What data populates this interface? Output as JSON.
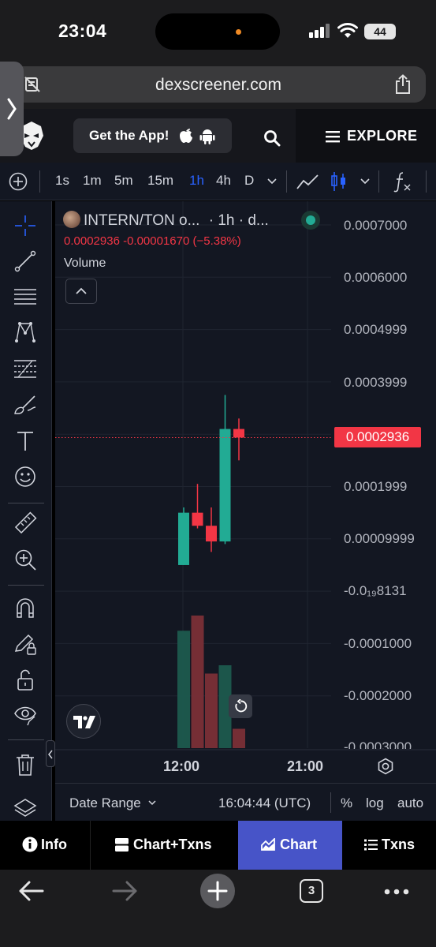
{
  "status_bar": {
    "time": "23:04",
    "battery": "44"
  },
  "browser": {
    "url": "dexscreener.com"
  },
  "site_header": {
    "get_app_label": "Get the App!",
    "explore_label": "EXPLORE"
  },
  "toolbar": {
    "intervals": [
      "1s",
      "1m",
      "5m",
      "15m",
      "1h",
      "4h",
      "D"
    ],
    "active_interval": "1h"
  },
  "chart": {
    "symbol_title": "INTERN/TON o...",
    "interval_suffix": "· 1h · d...",
    "ohlc_line": "0.0002936  -0.00001670 (−5.38%)",
    "volume_label": "Volume",
    "current_price_tag": "0.0002936",
    "y_axis_labels": [
      "0.0007000",
      "0.0006000",
      "0.0004999",
      "0.0003999",
      "0.0001999",
      "0.00009999",
      "-0.0₁₉8131",
      "-0.0001000",
      "-0.0002000",
      "-0.0003000"
    ],
    "x_axis_labels": [
      "12:00",
      "21:00"
    ],
    "colors": {
      "up": "#22ab94",
      "down": "#f23645",
      "background": "#131722",
      "accent": "#2962ff"
    }
  },
  "chart_data": {
    "type": "candlestick",
    "pair": "INTERN/TON",
    "interval": "1h",
    "y_ticks": [
      0.0007,
      0.0006,
      0.0004999,
      0.0003999,
      0.0001999,
      9.999e-05
    ],
    "ylim": [
      -0.0003,
      0.0007
    ],
    "candles": [
      {
        "open": 5e-05,
        "high": 0.00016,
        "low": 5e-05,
        "close": 0.00015,
        "dir": "up"
      },
      {
        "open": 0.00015,
        "high": 0.000205,
        "low": 0.00012,
        "close": 0.000125,
        "dir": "down"
      },
      {
        "open": 0.000125,
        "high": 0.00016,
        "low": 7.5e-05,
        "close": 9.5e-05,
        "dir": "down"
      },
      {
        "open": 9.5e-05,
        "high": 0.000375,
        "low": 9e-05,
        "close": 0.00031,
        "dir": "up"
      },
      {
        "open": 0.00031,
        "high": 0.00033,
        "low": 0.00025,
        "close": 0.0002936,
        "dir": "down"
      }
    ],
    "volume_rel": [
      0.85,
      0.96,
      0.54,
      0.6,
      0.14
    ],
    "current_price": 0.0002936,
    "x_labels": [
      "12:00",
      "21:00"
    ]
  },
  "chart_footer": {
    "date_range": "Date Range",
    "time_utc": "16:04:44 (UTC)",
    "percent": "%",
    "log": "log",
    "auto": "auto"
  },
  "tabs": [
    {
      "label": "Info",
      "active": false
    },
    {
      "label": "Chart+Txns",
      "active": false
    },
    {
      "label": "Chart",
      "active": true
    },
    {
      "label": "Txns",
      "active": false
    }
  ],
  "safari": {
    "tab_count": "3"
  }
}
